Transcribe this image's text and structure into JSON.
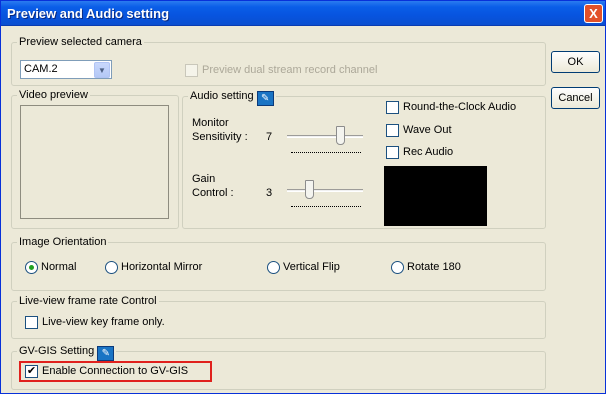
{
  "window": {
    "title": "Preview and Audio setting",
    "close_glyph": "X"
  },
  "buttons": {
    "ok": "OK",
    "cancel": "Cancel"
  },
  "preview_camera": {
    "legend": "Preview selected camera",
    "camera_value": "CAM.2",
    "dual_stream_label": "Preview dual stream record channel",
    "dual_stream_checked": false
  },
  "video_preview": {
    "legend": "Video preview"
  },
  "audio_setting": {
    "legend": "Audio setting",
    "monitor_label_1": "Monitor",
    "monitor_label_2": "Sensitivity :",
    "monitor_value": "7",
    "monitor_level": 0.7,
    "gain_label_1": "Gain",
    "gain_label_2": "Control :",
    "gain_value": "3",
    "gain_level": 0.3,
    "round_clock_label": "Round-the-Clock Audio",
    "wave_out_label": "Wave Out",
    "rec_audio_label": "Rec Audio"
  },
  "image_orientation": {
    "legend": "Image Orientation",
    "options": [
      "Normal",
      "Horizontal Mirror",
      "Vertical Flip",
      "Rotate 180"
    ],
    "selected": "Normal"
  },
  "live_view": {
    "legend": "Live-view frame rate Control",
    "key_frame_label": "Live-view key frame only."
  },
  "gvgis": {
    "legend": "GV-GIS Setting",
    "enable_label": "Enable Connection to GV-GIS",
    "enable_checked": true
  },
  "colors": {
    "highlight": "#e0211d",
    "title_bar": "#0754df"
  }
}
